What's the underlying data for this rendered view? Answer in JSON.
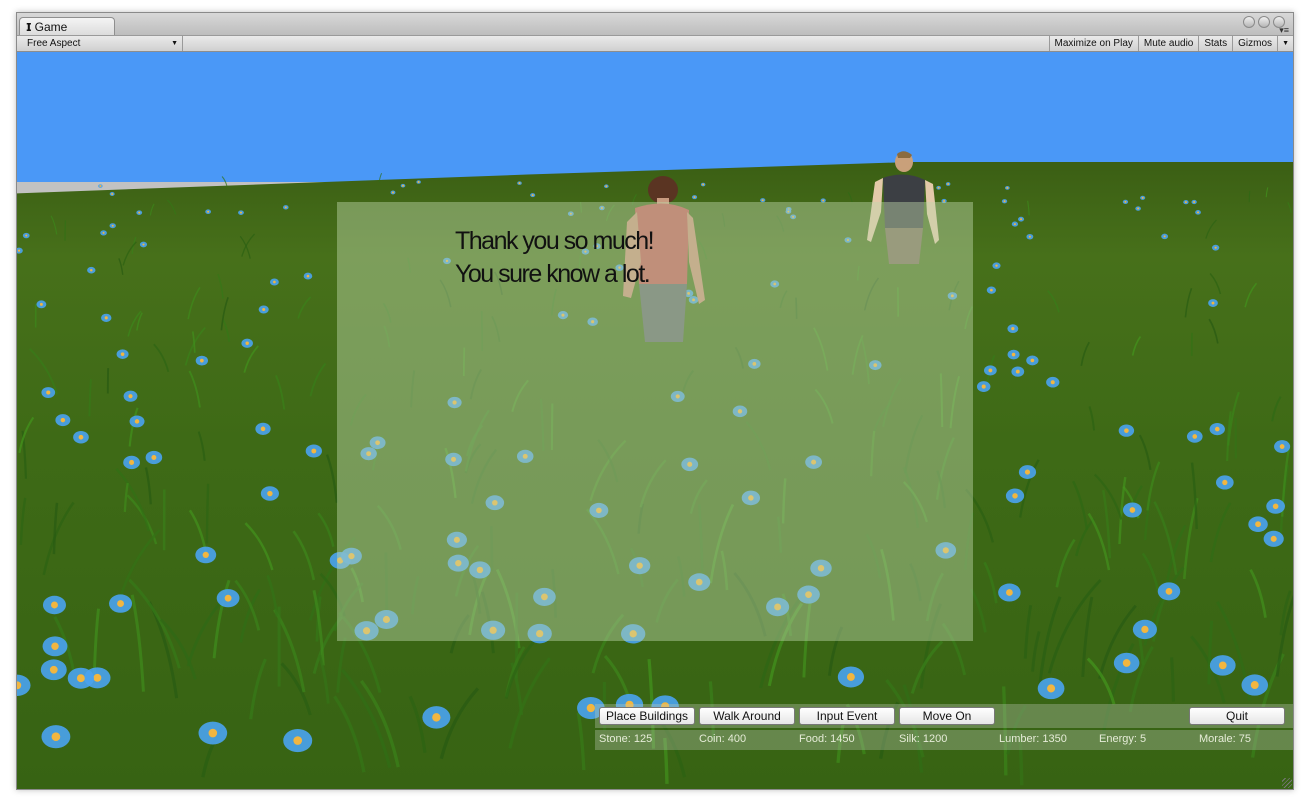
{
  "window": {
    "tab_label": "Game",
    "tab_icon": "unity-icon",
    "aspect_label": "Free Aspect",
    "toolbar_buttons": [
      "Maximize on Play",
      "Mute audio",
      "Stats",
      "Gizmos"
    ]
  },
  "scene": {
    "sky_color": "#4a98f7",
    "grass_color": "#41691a",
    "flower_color": "#4aa3f0",
    "characters": [
      "player-character",
      "npc-character"
    ]
  },
  "dialogue": {
    "line1": "Thank you so much!",
    "line2": "You sure know a lot."
  },
  "hud": {
    "buttons": {
      "place_buildings": "Place Buildings",
      "walk_around": "Walk Around",
      "input_event": "Input Event",
      "move_on": "Move On",
      "quit": "Quit"
    },
    "stats": {
      "stone": "Stone: 125",
      "coin": "Coin: 400",
      "food": "Food: 1450",
      "silk": "Silk: 1200",
      "lumber": "Lumber: 1350",
      "energy": "Energy: 5",
      "morale": "Morale: 75"
    }
  }
}
